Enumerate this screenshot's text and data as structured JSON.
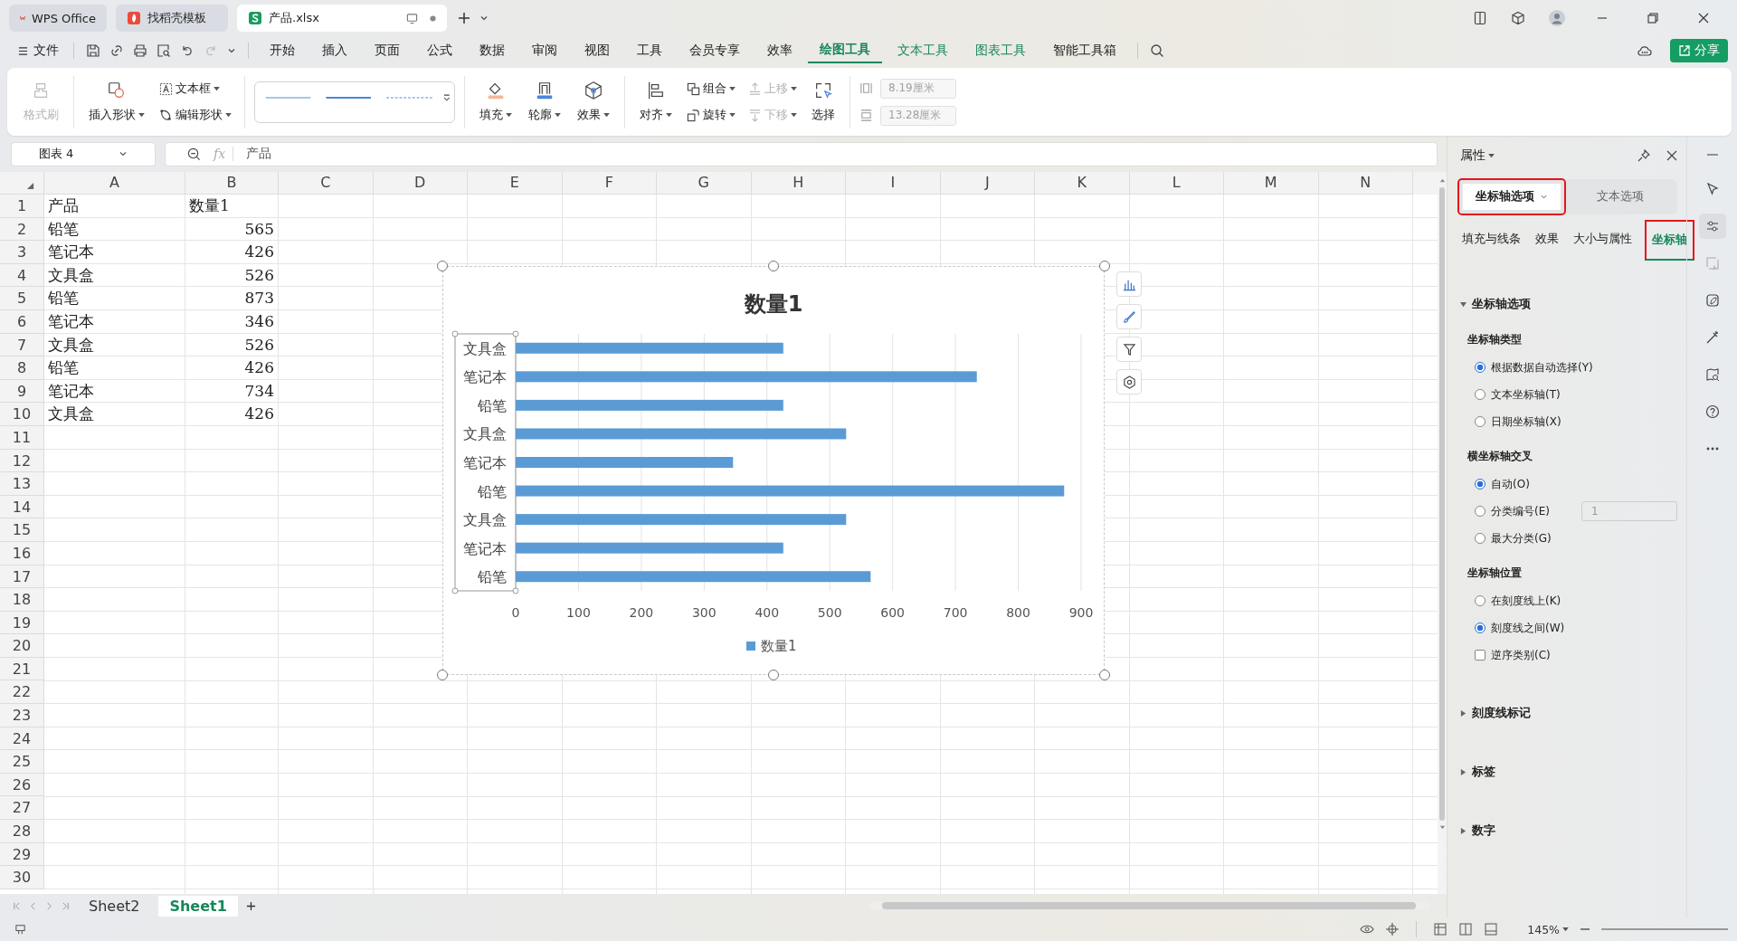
{
  "tabs": [
    {
      "label": "WPS Office",
      "kind": "wps",
      "selected": false
    },
    {
      "label": "找稻壳模板",
      "kind": "docer",
      "selected": false
    },
    {
      "label": "产品.xlsx",
      "kind": "sheet",
      "selected": true
    }
  ],
  "menu": {
    "file": "文件",
    "items": [
      {
        "label": "开始",
        "kind": "plain",
        "selected": false
      },
      {
        "label": "插入",
        "kind": "plain",
        "selected": false
      },
      {
        "label": "页面",
        "kind": "plain",
        "selected": false
      },
      {
        "label": "公式",
        "kind": "plain",
        "selected": false
      },
      {
        "label": "数据",
        "kind": "plain",
        "selected": false
      },
      {
        "label": "审阅",
        "kind": "plain",
        "selected": false
      },
      {
        "label": "视图",
        "kind": "plain",
        "selected": false
      },
      {
        "label": "工具",
        "kind": "plain",
        "selected": false
      },
      {
        "label": "会员专享",
        "kind": "plain",
        "selected": false
      },
      {
        "label": "效率",
        "kind": "plain",
        "selected": false
      },
      {
        "label": "绘图工具",
        "kind": "context",
        "selected": true
      },
      {
        "label": "文本工具",
        "kind": "context",
        "selected": false
      },
      {
        "label": "图表工具",
        "kind": "context",
        "selected": false
      },
      {
        "label": "智能工具箱",
        "kind": "plain",
        "selected": false
      }
    ],
    "share": "分享"
  },
  "ribbon": {
    "format_painter": {
      "label": "格式刷",
      "disabled": true
    },
    "insert_shape": "插入形状",
    "text_box": "文本框",
    "edit_shape": "编辑形状",
    "fill": "填充",
    "outline": "轮廓",
    "effect": "效果",
    "align": "对齐",
    "group": "组合",
    "rotate": "旋转",
    "bring_forward": {
      "label": "上移",
      "disabled": true
    },
    "send_backward": {
      "label": "下移",
      "disabled": true
    },
    "select": "选择",
    "width": "8.19厘米",
    "height": "13.28厘米"
  },
  "formula_bar": {
    "name_box": "图表 4",
    "fx": "fx",
    "value": "产品"
  },
  "sheet": {
    "columns": [
      "A",
      "B",
      "C",
      "D",
      "E",
      "F",
      "G",
      "H",
      "I",
      "J",
      "K",
      "L",
      "M",
      "N"
    ],
    "row_numbers": [
      "1",
      "2",
      "3",
      "4",
      "5",
      "6",
      "7",
      "8",
      "9",
      "10",
      "11",
      "12",
      "13",
      "14",
      "15",
      "16",
      "17",
      "18",
      "19",
      "20",
      "21",
      "22",
      "23",
      "24",
      "25",
      "26",
      "27",
      "28",
      "29",
      "30"
    ],
    "rows": [
      [
        "产品",
        "数量1"
      ],
      [
        "铅笔",
        "565"
      ],
      [
        "笔记本",
        "426"
      ],
      [
        "文具盒",
        "526"
      ],
      [
        "铅笔",
        "873"
      ],
      [
        "笔记本",
        "346"
      ],
      [
        "文具盒",
        "526"
      ],
      [
        "铅笔",
        "426"
      ],
      [
        "笔记本",
        "734"
      ],
      [
        "文具盒",
        "426"
      ]
    ]
  },
  "chart": {
    "chart_data": {
      "type": "bar",
      "orientation": "horizontal",
      "title": "数量1",
      "categories": [
        "文具盒",
        "笔记本",
        "铅笔",
        "文具盒",
        "笔记本",
        "铅笔",
        "文具盒",
        "笔记本",
        "铅笔"
      ],
      "series": [
        {
          "name": "数量1",
          "color": "#5b9bd5",
          "values": [
            426,
            734,
            426,
            526,
            346,
            873,
            526,
            426,
            565
          ]
        }
      ],
      "xlim": [
        0,
        900
      ],
      "grid": true,
      "xticks": [
        0,
        100,
        200,
        300,
        400,
        500,
        600,
        700,
        800,
        900
      ]
    }
  },
  "panel": {
    "title": "属性",
    "tabs": [
      {
        "label": "坐标轴选项",
        "selected": true,
        "highlighted": true
      },
      {
        "label": "文本选项",
        "selected": false,
        "highlighted": false
      }
    ],
    "subtabs": [
      {
        "label": "填充与线条",
        "selected": false,
        "highlighted": false
      },
      {
        "label": "效果",
        "selected": false,
        "highlighted": false
      },
      {
        "label": "大小与属性",
        "selected": false,
        "highlighted": false
      },
      {
        "label": "坐标轴",
        "selected": true,
        "highlighted": true
      }
    ],
    "sections": [
      {
        "title": "坐标轴选项",
        "expanded": true,
        "groups": [
          {
            "title": "坐标轴类型",
            "options": [
              {
                "kind": "radio",
                "label": "根据数据自动选择(Y)",
                "checked": true
              },
              {
                "kind": "radio",
                "label": "文本坐标轴(T)",
                "checked": false
              },
              {
                "kind": "radio",
                "label": "日期坐标轴(X)",
                "checked": false
              }
            ]
          },
          {
            "title": "横坐标轴交叉",
            "options": [
              {
                "kind": "radio",
                "label": "自动(O)",
                "checked": true
              },
              {
                "kind": "radio",
                "label": "分类编号(E)",
                "checked": false,
                "field": "1"
              },
              {
                "kind": "radio",
                "label": "最大分类(G)",
                "checked": false
              }
            ]
          },
          {
            "title": "坐标轴位置",
            "options": [
              {
                "kind": "radio",
                "label": "在刻度线上(K)",
                "checked": false
              },
              {
                "kind": "radio",
                "label": "刻度线之间(W)",
                "checked": true
              },
              {
                "kind": "checkbox",
                "label": "逆序类别(C)",
                "checked": false
              }
            ]
          }
        ]
      },
      {
        "title": "刻度线标记",
        "expanded": false
      },
      {
        "title": "标签",
        "expanded": false
      },
      {
        "title": "数字",
        "expanded": false
      }
    ]
  },
  "side_tools": [
    {
      "kind": "cursor",
      "selected": false
    },
    {
      "kind": "sliders",
      "selected": true
    },
    {
      "kind": "frame",
      "selected": false
    },
    {
      "kind": "leaf",
      "selected": false
    },
    {
      "kind": "wand",
      "selected": false
    },
    {
      "kind": "book",
      "selected": false
    },
    {
      "kind": "help",
      "selected": false
    },
    {
      "kind": "more",
      "selected": false
    }
  ],
  "sheet_tabs": [
    {
      "label": "Sheet2",
      "selected": false
    },
    {
      "label": "Sheet1",
      "selected": true
    }
  ],
  "status": {
    "zoom": "145%"
  }
}
